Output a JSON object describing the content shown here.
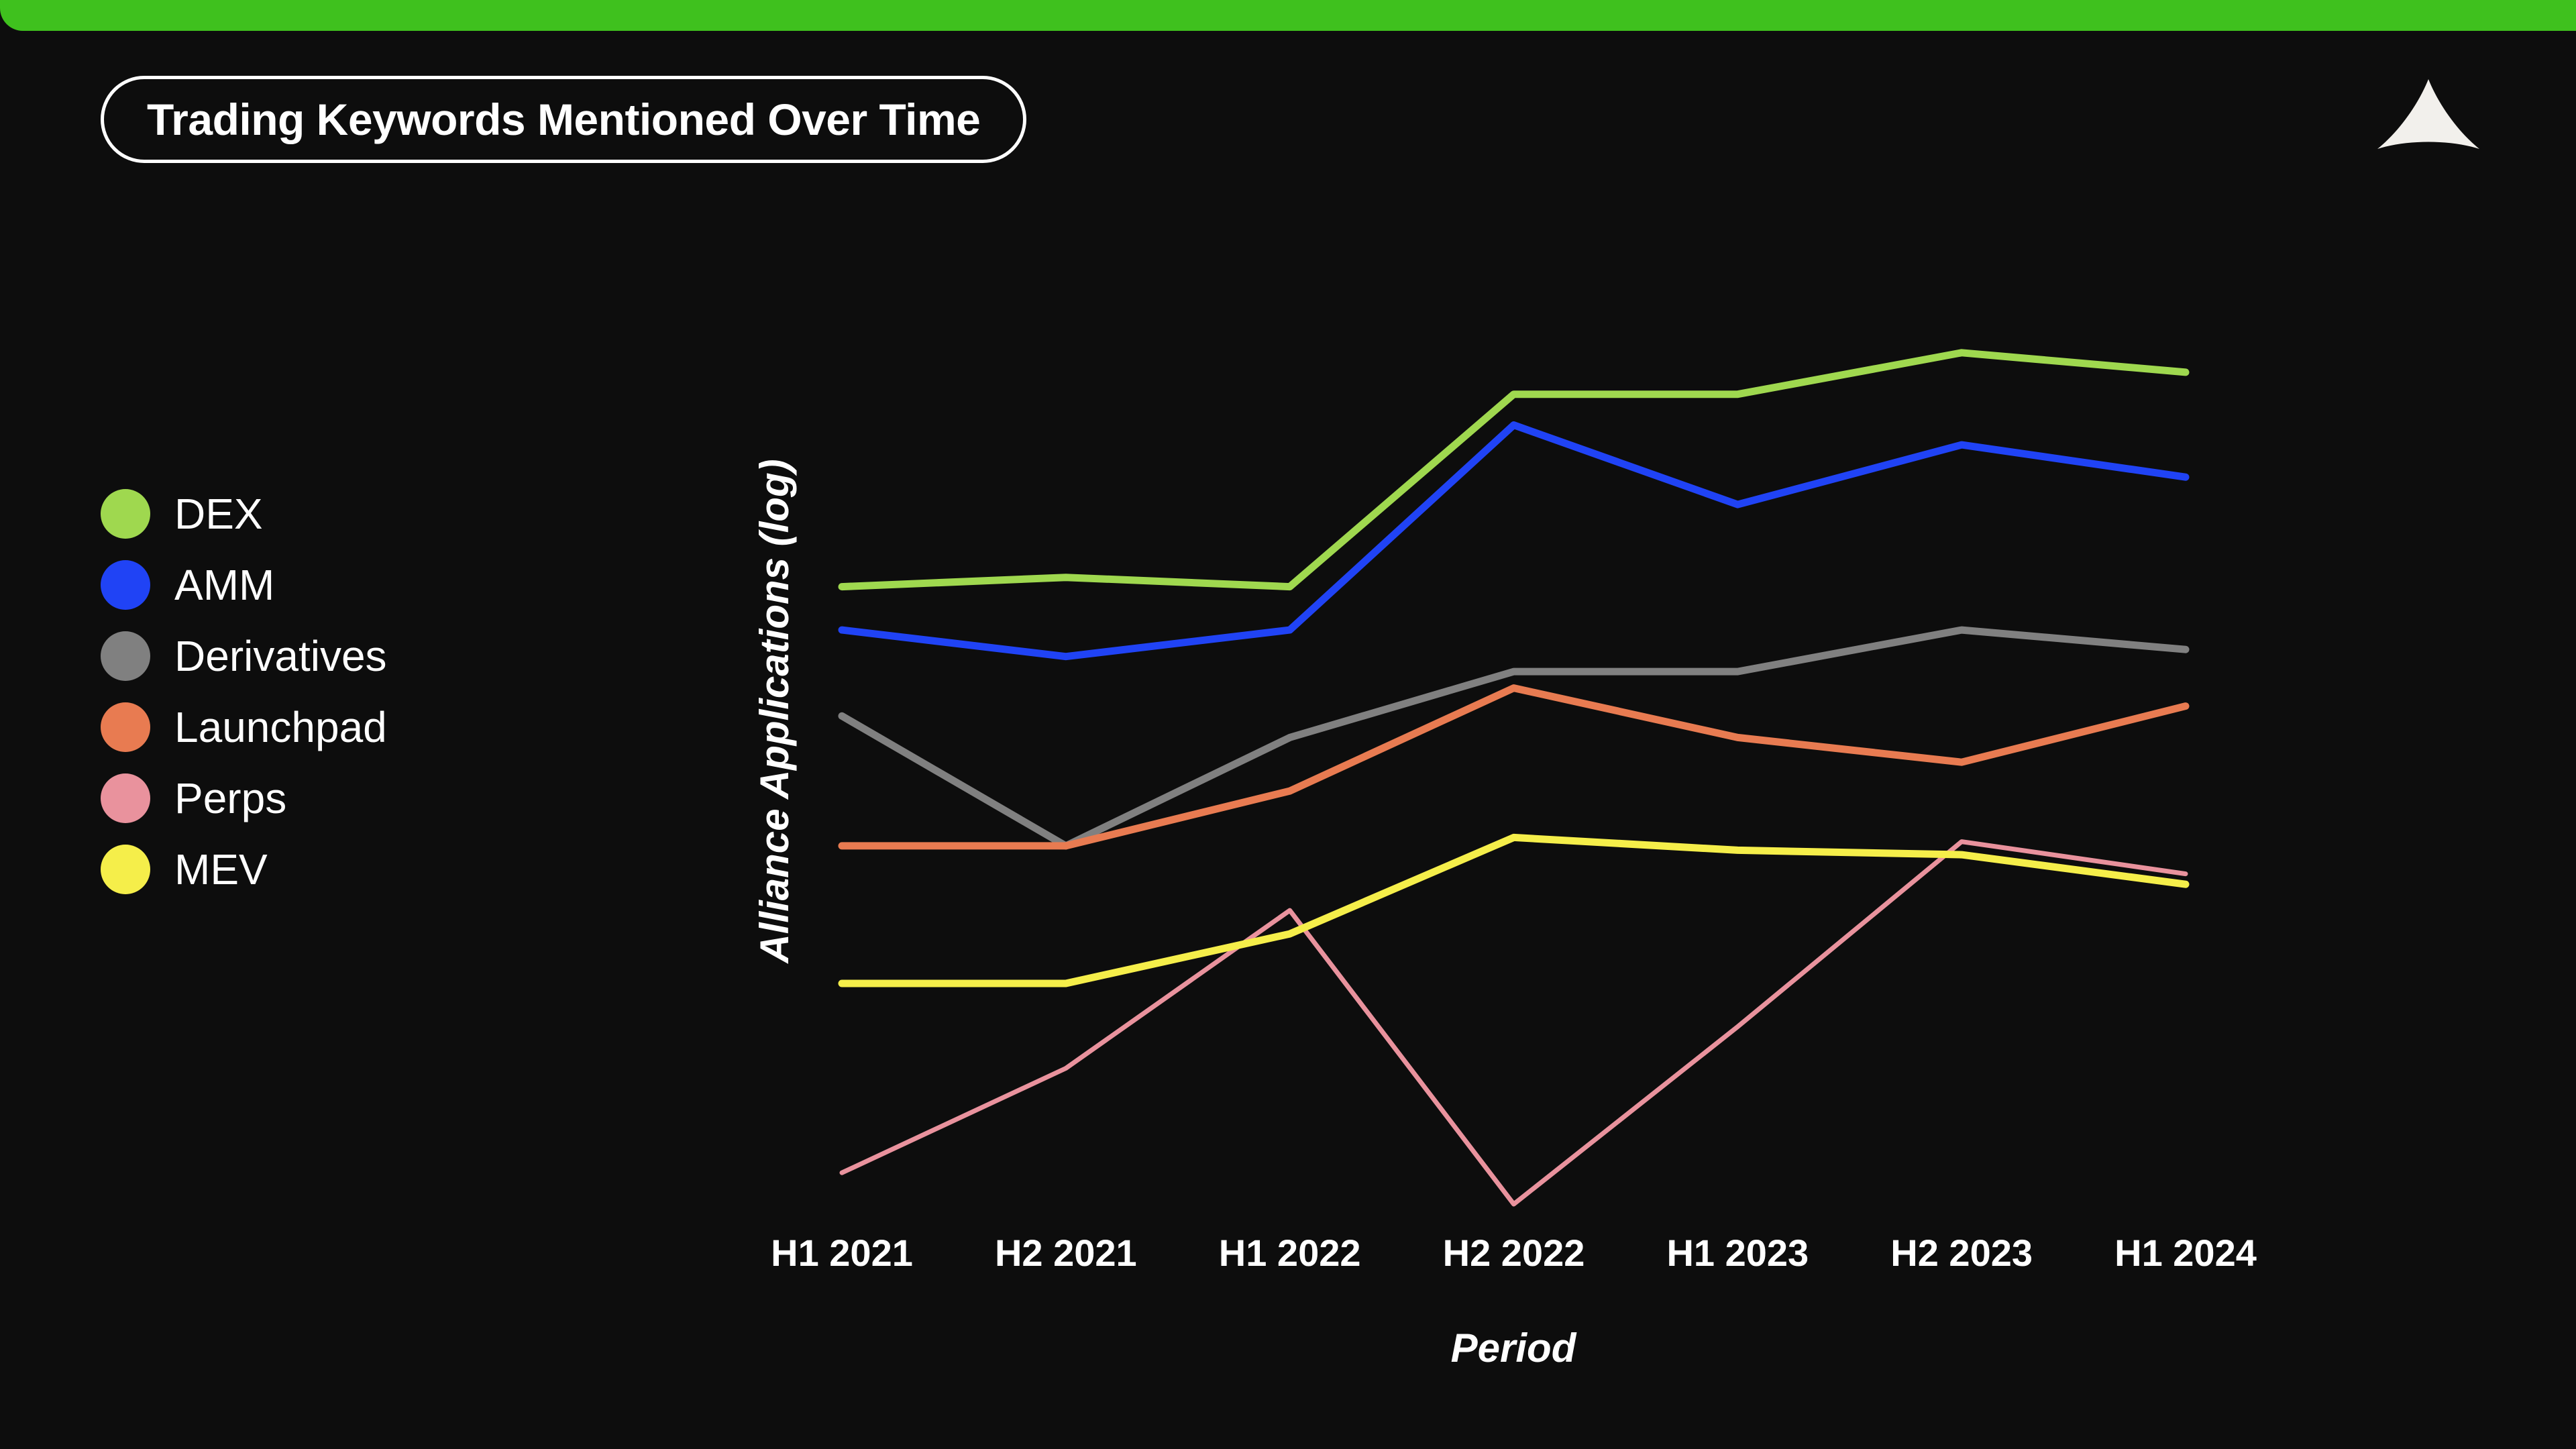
{
  "brand": {
    "top_bar_color": "#3fc11e",
    "logo_name": "alliance-arrow-logo",
    "background_color": "#0d0d0d"
  },
  "header": {
    "title": "Trading Keywords Mentioned Over Time"
  },
  "legend": {
    "position": "left",
    "items": [
      {
        "label": "DEX",
        "color": "#9fd84f"
      },
      {
        "label": "AMM",
        "color": "#2043f5"
      },
      {
        "label": "Derivatives",
        "color": "#808080"
      },
      {
        "label": "Launchpad",
        "color": "#e87b51"
      },
      {
        "label": "Perps",
        "color": "#e9929d"
      },
      {
        "label": "MEV",
        "color": "#f5ee4a"
      }
    ]
  },
  "chart_data": {
    "type": "line",
    "title": "Trading Keywords Mentioned Over Time",
    "xlabel": "Period",
    "ylabel": "Alliance Applications (log)",
    "grid": false,
    "legend_position": "left",
    "yscale": "log",
    "categories": [
      "H1 2021",
      "H2 2021",
      "H1 2022",
      "H2 2022",
      "H1 2023",
      "H2 2023",
      "H1 2024"
    ],
    "ylim": [
      1,
      300
    ],
    "series": [
      {
        "name": "DEX",
        "color": "#9fd84f",
        "values": [
          36,
          38,
          36,
          110,
          110,
          140,
          125
        ]
      },
      {
        "name": "AMM",
        "color": "#2043f5",
        "values": [
          28,
          24,
          28,
          92,
          58,
          82,
          68
        ]
      },
      {
        "name": "Derivatives",
        "color": "#808080",
        "values": [
          17,
          8,
          15,
          22,
          22,
          28,
          25
        ]
      },
      {
        "name": "Launchpad",
        "color": "#e87b51",
        "values": [
          8,
          8,
          11,
          20,
          15,
          13,
          18
        ]
      },
      {
        "name": "Perps",
        "color": "#e9929d",
        "values": [
          1.2,
          2.2,
          5.5,
          1.0,
          2.8,
          8.2,
          6.8
        ]
      },
      {
        "name": "MEV",
        "color": "#f5ee4a",
        "values": [
          3.6,
          3.6,
          4.8,
          8.4,
          7.8,
          7.6,
          6.4
        ]
      }
    ]
  }
}
